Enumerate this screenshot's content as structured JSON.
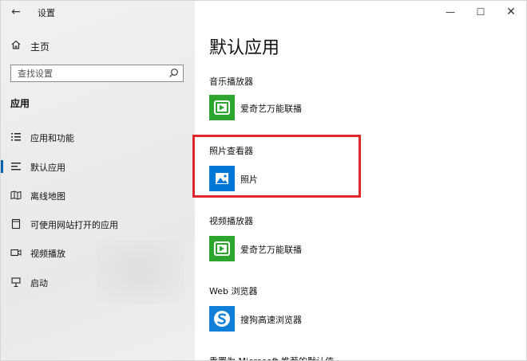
{
  "window": {
    "title": "设置",
    "back_icon": "back-arrow-icon",
    "controls": [
      "minimize-icon",
      "maximize-icon",
      "close-icon"
    ]
  },
  "sidebar": {
    "home_label": "主页",
    "search_placeholder": "查找设置",
    "section_title": "应用",
    "items": [
      {
        "label": "应用和功能",
        "icon": "list-icon"
      },
      {
        "label": "默认应用",
        "icon": "default-apps-icon",
        "active": true
      },
      {
        "label": "离线地图",
        "icon": "map-icon"
      },
      {
        "label": "可使用网站打开的应用",
        "icon": "web-app-icon"
      },
      {
        "label": "视频播放",
        "icon": "video-icon"
      },
      {
        "label": "启动",
        "icon": "startup-icon"
      }
    ]
  },
  "main": {
    "title": "默认应用",
    "groups": [
      {
        "label": "音乐播放器",
        "app": "爱奇艺万能联播",
        "icon": "iqiyi-icon"
      },
      {
        "label": "照片查看器",
        "app": "照片",
        "icon": "photos-icon"
      },
      {
        "label": "视频播放器",
        "app": "爱奇艺万能联播",
        "icon": "iqiyi-icon"
      },
      {
        "label": "Web 浏览器",
        "app": "搜狗高速浏览器",
        "icon": "sogou-browser-icon"
      }
    ],
    "reset_text": "重置为 Microsoft 推荐的默认值"
  },
  "colors": {
    "accent": "#0063b1",
    "highlight_box": "#e0252b",
    "iqiyi_green": "#2ea52e",
    "photos_blue": "#0078d7"
  }
}
